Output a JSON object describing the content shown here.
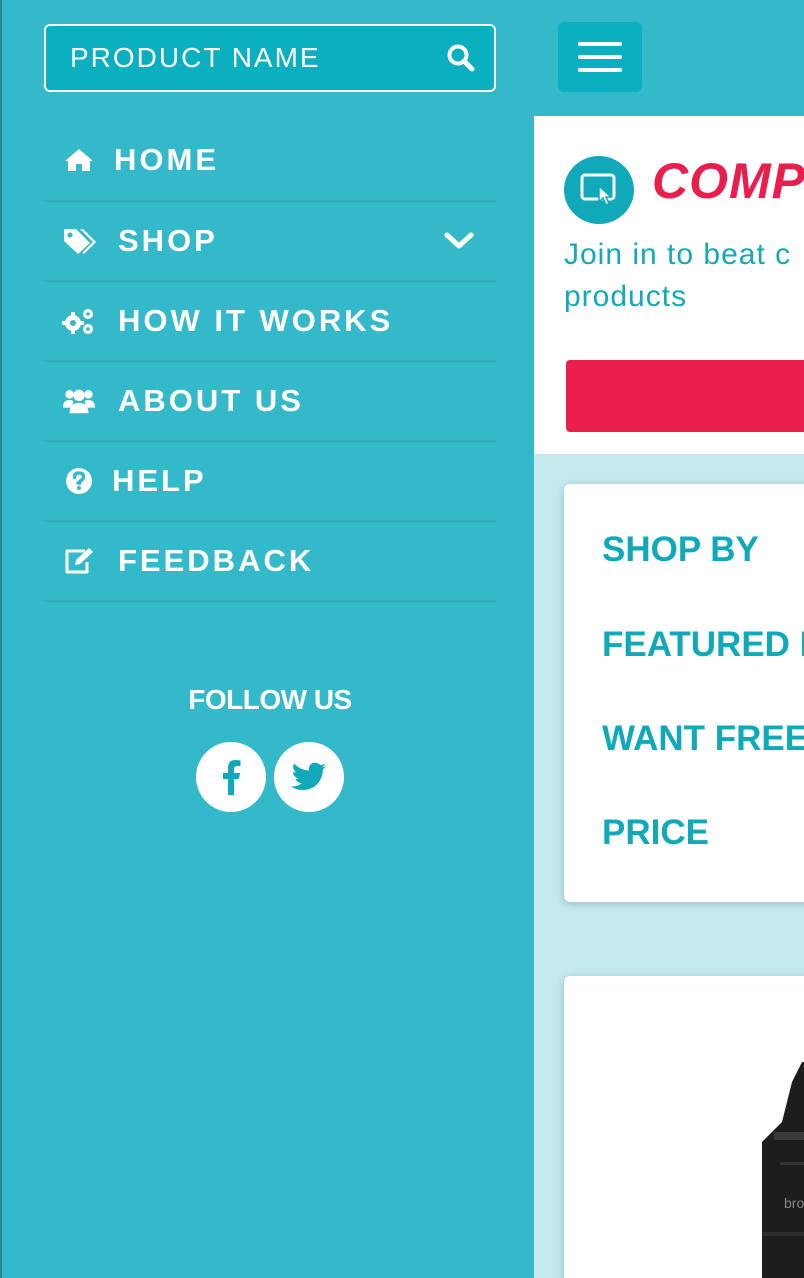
{
  "search": {
    "placeholder": "PRODUCT NAME"
  },
  "nav": {
    "items": [
      {
        "label": "HOME",
        "icon": "home-icon"
      },
      {
        "label": "SHOP",
        "icon": "tags-icon",
        "has_submenu": true
      },
      {
        "label": "HOW IT WORKS",
        "icon": "gears-icon"
      },
      {
        "label": "ABOUT US",
        "icon": "users-icon"
      },
      {
        "label": "HELP",
        "icon": "question-circle-icon"
      },
      {
        "label": "FEEDBACK",
        "icon": "edit-icon"
      }
    ]
  },
  "follow": {
    "title": "FOLLOW US",
    "networks": [
      "facebook-icon",
      "twitter-icon"
    ]
  },
  "hero": {
    "title": "COMP",
    "subtitle": "Join in to beat c products",
    "subtitle_line1": "Join in to beat c",
    "subtitle_line2": "products"
  },
  "filters": {
    "items": [
      "SHOP BY",
      "FEATURED I",
      "WANT FREE",
      "PRICE"
    ]
  },
  "colors": {
    "drawer_bg": "#33b9c9",
    "accent_teal": "#0fa9ba",
    "accent_pink": "#e91e4c",
    "content_bg": "#c3e9ee",
    "text_light": "#ffffff"
  }
}
